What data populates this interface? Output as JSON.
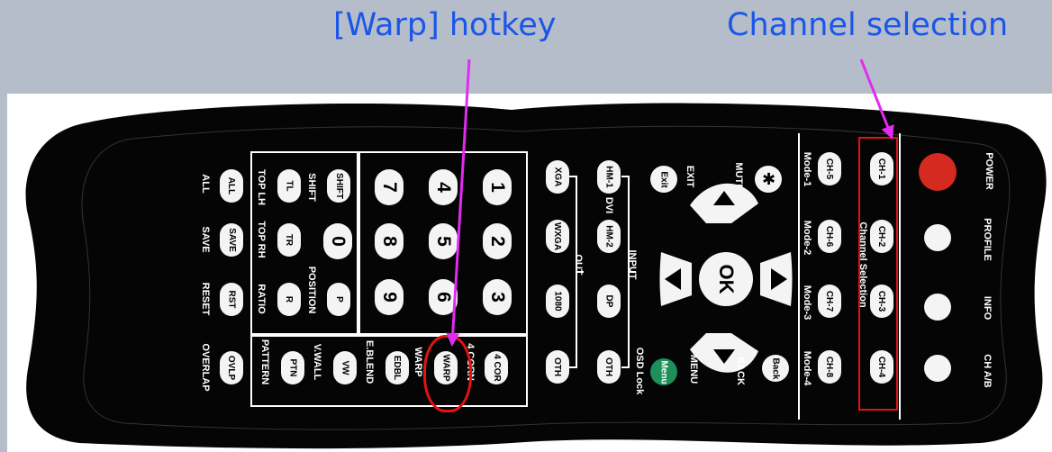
{
  "callouts": {
    "warp_hotkey": "[Warp] hotkey",
    "channel_selection": "Channel selection"
  },
  "remote": {
    "power_label": "POWER",
    "profile_label": "PROFILE",
    "info_label": "INFO",
    "ch_ab_label": "CH A/B",
    "channel_selection_label": "Channel Selection",
    "channel_buttons": [
      "CH-1",
      "CH-2",
      "CH-3",
      "CH-4"
    ],
    "mode_buttons": [
      "CH-5",
      "CH-6",
      "CH-7",
      "CH-8"
    ],
    "mode_labels": [
      "Mode-1",
      "Mode-2",
      "Mode-3",
      "Mode-4"
    ],
    "mute_label": "MUTE",
    "exit_button": "Exit",
    "exit_label": "EXIT",
    "ok_label": "OK",
    "back_button": "Back",
    "back_label": "BACK",
    "menu_button": "Menu",
    "menu_label": "MENU",
    "osd_lock_label": "OSD Lock",
    "input_label": "INPUT",
    "dvi_label": "DVI",
    "out_label": "OUT",
    "input_buttons": [
      "HM-1",
      "HM-2",
      "DP",
      "OTH"
    ],
    "output_buttons": [
      "XGA",
      "WXGA",
      "1080",
      "OTH"
    ],
    "numbers": [
      "1",
      "2",
      "3",
      "4",
      "5",
      "6",
      "7",
      "8",
      "9"
    ],
    "zero": "0",
    "four_corn_button": "4 COR",
    "four_corn_label": "4 CORN",
    "warp_button": "WARP",
    "warp_label": "WARP",
    "edbl_button": "EDBL",
    "eblend_label": "E.BLEND",
    "vw_button": "VW",
    "vwall_label": "V.WALL",
    "ptn_button": "PTN",
    "pattern_label": "PATTERN",
    "ovlp_button": "OVLP",
    "overlap_label": "OVERLAP",
    "p_button": "P",
    "position_label": "POSITION",
    "r_button": "R",
    "ratio_label": "RATIO",
    "shift_button": "SHIFT",
    "shift_label": "SHIFT",
    "tl_button": "TL",
    "top_lh_label": "TOP LH",
    "tr_button": "TR",
    "top_rh_label": "TOP RH",
    "all_button": "ALL",
    "all_label": "ALL",
    "save_button": "SAVE",
    "save_label": "SAVE",
    "rst_button": "RST",
    "reset_label": "RESET"
  },
  "colors": {
    "background": "#b5bdca",
    "callout_text": "#1a56e8",
    "arrow": "#e22bf0",
    "highlight": "#e21313",
    "power_button": "#d42a1f",
    "menu_button": "#1f8f5a"
  }
}
